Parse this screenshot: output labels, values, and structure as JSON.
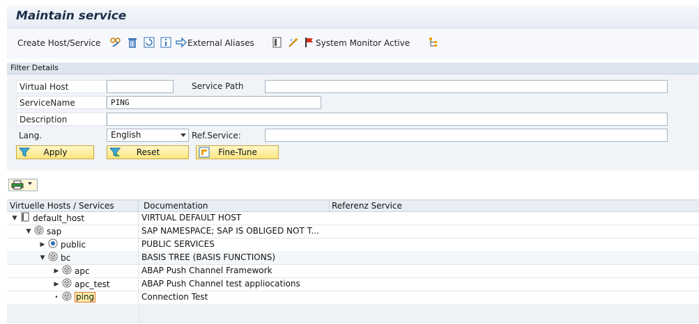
{
  "header": {
    "title": "Maintain service"
  },
  "toolbar": {
    "create_label": "Create Host/Service",
    "external_aliases_label": "External Aliases",
    "system_monitor_label": "System Monitor Active"
  },
  "filter": {
    "section_title": "Filter Details",
    "virtual_host_label": "Virtual Host",
    "virtual_host_value": "",
    "service_path_label": "Service Path",
    "service_path_value": "",
    "service_name_label": "ServiceName",
    "service_name_value": "PING",
    "description_label": "Description",
    "description_value": "",
    "lang_label": "Lang.",
    "lang_value": "English",
    "ref_service_label": "Ref.Service:",
    "ref_service_value": "",
    "apply_label": "Apply",
    "reset_label": "Reset",
    "fine_tune_label": "Fine-Tune"
  },
  "grid": {
    "columns": [
      "Virtuelle Hosts / Services",
      "Documentation",
      "Referenz Service"
    ],
    "rows": [
      {
        "name": "default_host",
        "doc": "VIRTUAL DEFAULT HOST",
        "expander": "▼",
        "icon": "page-icon",
        "level": 0
      },
      {
        "name": "sap",
        "doc": "SAP NAMESPACE; SAP IS OBLIGED NOT T...",
        "expander": "▼",
        "icon": "package-icon",
        "level": 1
      },
      {
        "name": "public",
        "doc": "PUBLIC SERVICES",
        "expander": "▶",
        "icon": "radio-icon",
        "level": 2
      },
      {
        "name": "bc",
        "doc": "BASIS TREE (BASIS FUNCTIONS)",
        "expander": "▼",
        "icon": "package-icon",
        "level": 2
      },
      {
        "name": "apc",
        "doc": "ABAP Push Channel Framework",
        "expander": "▶",
        "icon": "package-icon",
        "level": 3
      },
      {
        "name": "apc_test",
        "doc": "ABAP Push Channel test appliocations",
        "expander": "▶",
        "icon": "package-icon",
        "level": 3
      },
      {
        "name": "ping",
        "doc": "Connection Test",
        "expander": "•",
        "icon": "package-icon",
        "level": 3,
        "selected": true
      }
    ]
  },
  "colors": {
    "accent": "#1c2f4a",
    "button_bg": "#fde680",
    "selection_border": "#e46b2a"
  }
}
